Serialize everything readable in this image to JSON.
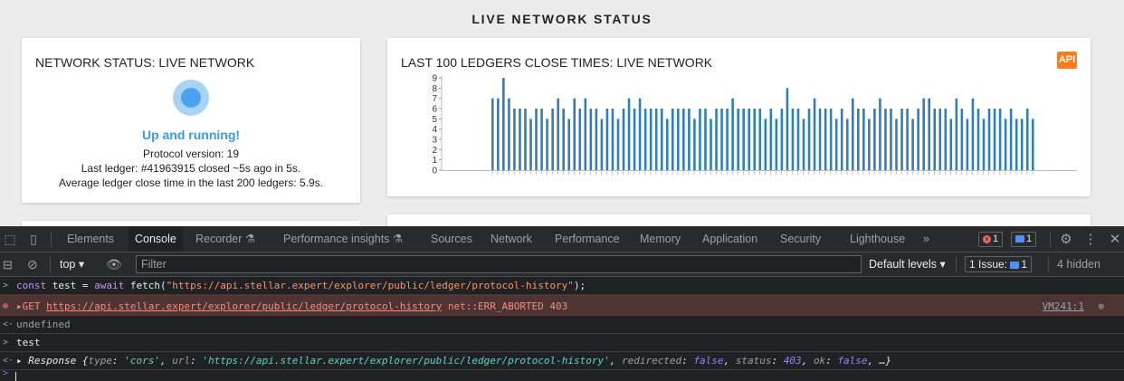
{
  "site": {
    "title": "LIVE NETWORK STATUS",
    "status_card": {
      "title": "NETWORK STATUS: LIVE NETWORK",
      "headline": "Up and running!",
      "protocol": "Protocol version: 19",
      "last_ledger": "Last ledger: #41963915 closed ~5s ago in 5s.",
      "average": "Average ledger close time in the last 200 ledgers: 5.9s."
    },
    "close_times_card": {
      "title": "LAST 100 LEDGERS CLOSE TIMES: LIVE NETWORK",
      "api_badge": "API"
    },
    "colors": {
      "accent": "#3a9ae0",
      "bar": "#2f7fba",
      "api": "#ff7a1a"
    }
  },
  "chart_data": {
    "type": "bar",
    "title": "LAST 100 LEDGERS CLOSE TIMES: LIVE NETWORK",
    "ylim": [
      0,
      9
    ],
    "yticks": [
      0,
      1,
      2,
      3,
      4,
      5,
      6,
      7,
      8,
      9
    ],
    "values": [
      7,
      7,
      9,
      7,
      6,
      6,
      6,
      5,
      6,
      6,
      5,
      6,
      7,
      6,
      5,
      7,
      6,
      7,
      6,
      6,
      5,
      6,
      6,
      5,
      6,
      7,
      6,
      7,
      6,
      6,
      6,
      6,
      5,
      6,
      6,
      6,
      6,
      5,
      6,
      6,
      5,
      6,
      6,
      6,
      7,
      6,
      6,
      6,
      6,
      6,
      5,
      6,
      5,
      6,
      8,
      6,
      6,
      5,
      6,
      7,
      6,
      6,
      6,
      5,
      6,
      5,
      7,
      6,
      6,
      5,
      6,
      7,
      6,
      6,
      5,
      6,
      6,
      5,
      6,
      7,
      7,
      6,
      6,
      6,
      5,
      7,
      6,
      5,
      7,
      6,
      5,
      6,
      6,
      6,
      5,
      6,
      5,
      5,
      6,
      5
    ]
  },
  "devtools": {
    "tabs": [
      "Elements",
      "Console",
      "Recorder",
      "Performance insights",
      "Sources",
      "Network",
      "Performance",
      "Memory",
      "Application",
      "Security",
      "Lighthouse"
    ],
    "more_tabs": "»",
    "error_count": "1",
    "message_count": "1",
    "context": "top",
    "filter_placeholder": "Filter",
    "levels": "Default levels",
    "issues_label": "1 Issue:",
    "issues_count": "1",
    "hidden": "4 hidden",
    "console": {
      "input_keyword_const": "const",
      "input_var": " test = ",
      "input_keyword_await": "await",
      "input_call": " fetch(",
      "input_url": "\"https://api.stellar.expert/explorer/public/ledger/protocol-history\"",
      "input_end": ");",
      "error_method": "GET",
      "error_url": "https://api.stellar.expert/explorer/public/ledger/protocol-history",
      "error_msg": "net::ERR_ABORTED 403",
      "error_source": "VM241:1",
      "result_undefined": "undefined",
      "typed_test": "test",
      "response_label": "Response",
      "resp_type_key": "type",
      "resp_type_val": "'cors'",
      "resp_url_key": "url",
      "resp_url_val": "'https://api.stellar.expert/explorer/public/ledger/protocol-history'",
      "resp_redirected_key": "redirected",
      "resp_redirected_val": "false",
      "resp_status_key": "status",
      "resp_status_val": "403",
      "resp_ok_key": "ok",
      "resp_ok_val": "false",
      "resp_more": "…}"
    }
  }
}
